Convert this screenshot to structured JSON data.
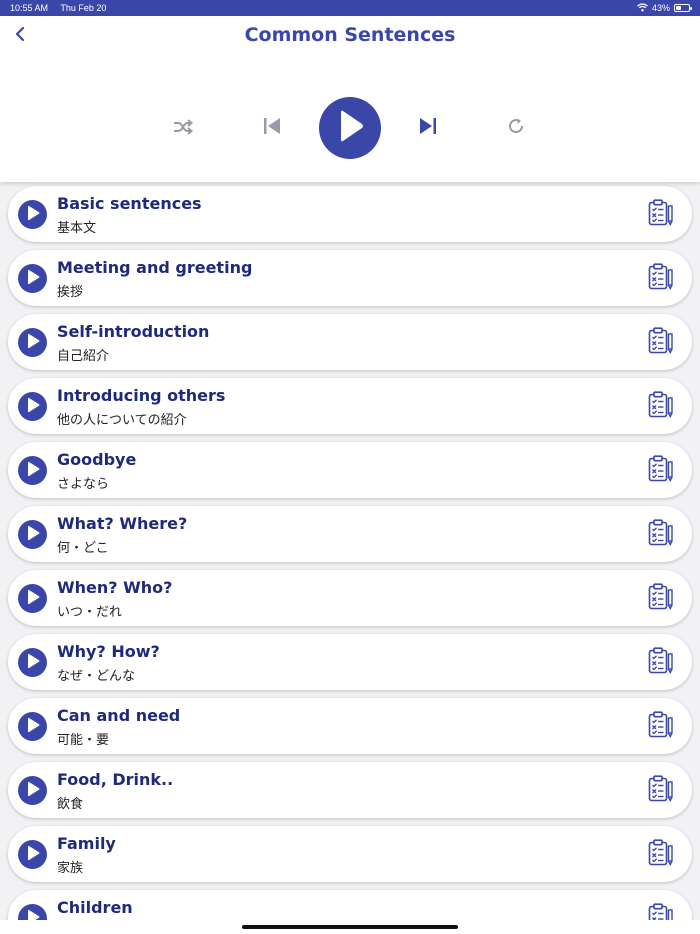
{
  "status_bar": {
    "time": "10:55 AM",
    "date": "Thu Feb 20",
    "battery_text": "43%",
    "battery_level": 0.43,
    "wifi_icon": "wifi-icon"
  },
  "header": {
    "title": "Common Sentences",
    "back_icon": "chevron-left-icon"
  },
  "controls": {
    "shuffle_icon": "shuffle-icon",
    "previous_icon": "skip-previous-icon",
    "play_icon": "play-icon",
    "next_icon": "skip-next-icon",
    "repeat_icon": "repeat-icon"
  },
  "colors": {
    "primary": "#3a47a8",
    "title_text": "#1f2a7a",
    "icon_gray": "#9a9aa6",
    "background": "#f2f2f5"
  },
  "items": [
    {
      "title": "Basic sentences",
      "subtitle": "基本文"
    },
    {
      "title": "Meeting and greeting",
      "subtitle": "挨拶"
    },
    {
      "title": "Self-introduction",
      "subtitle": "自己紹介"
    },
    {
      "title": "Introducing others",
      "subtitle": "他の人についての紹介"
    },
    {
      "title": "Goodbye",
      "subtitle": "さよなら"
    },
    {
      "title": "What? Where?",
      "subtitle": "何・どこ"
    },
    {
      "title": "When? Who?",
      "subtitle": "いつ・だれ"
    },
    {
      "title": "Why? How?",
      "subtitle": "なぜ・どんな"
    },
    {
      "title": "Can and need",
      "subtitle": "可能・要"
    },
    {
      "title": "Food, Drink..",
      "subtitle": "飲食"
    },
    {
      "title": "Family",
      "subtitle": "家族"
    },
    {
      "title": "Children",
      "subtitle": ""
    }
  ]
}
